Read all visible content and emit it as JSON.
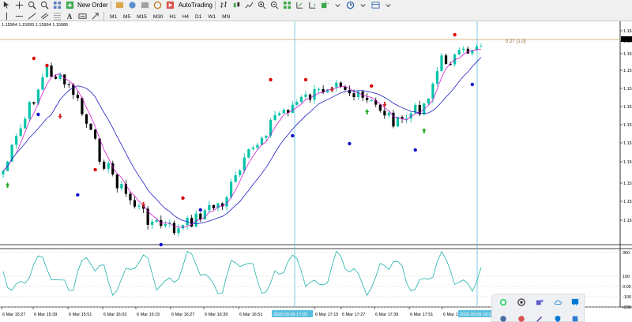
{
  "toolbar": {
    "new_order_label": "New Order",
    "autotrading_label": "AutoTrading",
    "timeframes": [
      "M1",
      "M5",
      "M15",
      "M30",
      "H1",
      "H4",
      "D1",
      "W1",
      "MN"
    ],
    "active_timeframe": ""
  },
  "chart": {
    "ohlc_text": "1.15964 1.15995 1.15964 1.15986",
    "trade_line_label": "0.27 (1.0)",
    "price_labels": [
      "1.16",
      "1.16",
      "1.15",
      "1.15",
      "1.15",
      "1.15",
      "1.15",
      "1.15",
      "1.15",
      "1.15",
      "1.15",
      "1.15"
    ],
    "osc_labels": [
      "360",
      "100",
      "0.00",
      "-100",
      "-236"
    ],
    "time_labels": [
      "6 Mar 15:27",
      "6 Mar 15:39",
      "6 Mar 15:51",
      "6 Mar 16:03",
      "6 Mar 16:15",
      "6 Mar 16:27",
      "6 Mar 16:39",
      "6 Mar 16:51",
      "6 Mar 17:15",
      "6 Mar 17:27",
      "6 Mar 17:39",
      "6 Mar 17:51",
      "6 Mar 1"
    ],
    "crosshair_time_1": "2026.03.06 17:03",
    "crosshair_time_2": "2026.03.06 18:0"
  },
  "colors": {
    "bull": "#00c3a8",
    "bear": "#000000",
    "ma_fast": "#d400d4",
    "ma_slow": "#2020c0",
    "osc": "#20b2aa",
    "crosshair": "#5bc0de",
    "trade_line": "#c8a060"
  },
  "icons": [
    "whatsapp-icon",
    "chrome-icon",
    "teams-icon",
    "cloud-icon",
    "store-icon",
    "settings-icon",
    "pen-icon",
    "security-icon",
    "app-icon"
  ]
}
